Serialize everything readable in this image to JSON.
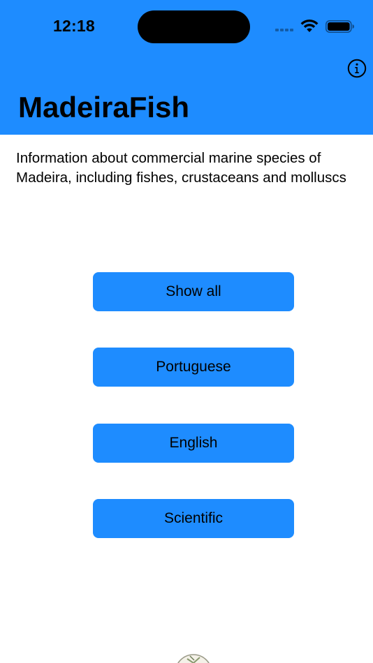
{
  "status_bar": {
    "time": "12:18"
  },
  "header": {
    "title": "MadeiraFish",
    "background_color": "#1e8cff",
    "info_icon": "info-circle-icon"
  },
  "description": "Information about commercial marine species of\nMadeira, including fishes, crustaceans and molluscs",
  "buttons": {
    "show_all": "Show all",
    "portuguese": "Portuguese",
    "english": "English",
    "scientific": "Scientific",
    "color": "#1e8cff"
  },
  "footer": {
    "logo_icon": "institution-logo"
  }
}
